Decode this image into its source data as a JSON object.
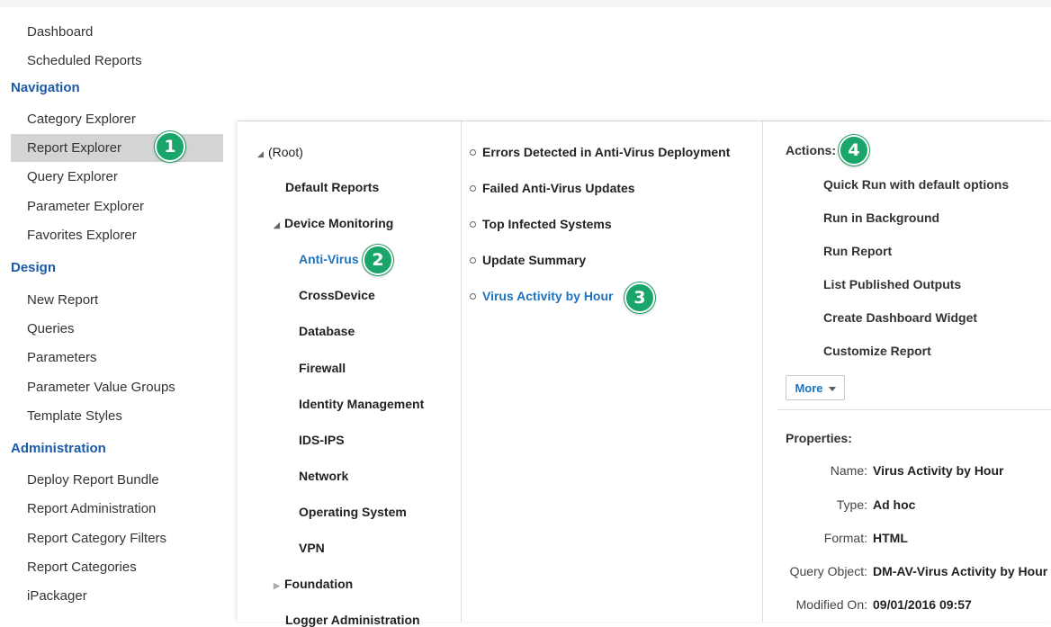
{
  "sidebar": {
    "top_items": [
      {
        "label": "Dashboard"
      },
      {
        "label": "Scheduled Reports"
      }
    ],
    "sections": [
      {
        "heading": "Navigation",
        "items": [
          {
            "label": "Category Explorer"
          },
          {
            "label": "Report Explorer",
            "selected": true
          },
          {
            "label": "Query Explorer"
          },
          {
            "label": "Parameter Explorer"
          },
          {
            "label": "Favorites Explorer"
          }
        ]
      },
      {
        "heading": "Design",
        "items": [
          {
            "label": "New Report"
          },
          {
            "label": "Queries"
          },
          {
            "label": "Parameters"
          },
          {
            "label": "Parameter Value Groups"
          },
          {
            "label": "Template Styles"
          }
        ]
      },
      {
        "heading": "Administration",
        "items": [
          {
            "label": "Deploy Report Bundle"
          },
          {
            "label": "Report Administration"
          },
          {
            "label": "Report Category Filters"
          },
          {
            "label": "Report Categories"
          },
          {
            "label": "iPackager"
          }
        ]
      }
    ]
  },
  "badges": [
    "1",
    "2",
    "3",
    "4"
  ],
  "tree": {
    "root": "(Root)",
    "default_reports": "Default Reports",
    "device_monitoring": "Device Monitoring",
    "children": [
      "Anti-Virus",
      "CrossDevice",
      "Database",
      "Firewall",
      "Identity Management",
      "IDS-IPS",
      "Network",
      "Operating System",
      "VPN"
    ],
    "foundation": "Foundation",
    "logger_admin": "Logger Administration"
  },
  "reports": [
    "Errors Detected in Anti-Virus Deployment",
    "Failed Anti-Virus Updates",
    "Top Infected Systems",
    "Update Summary",
    "Virus Activity by Hour"
  ],
  "actions": {
    "label": "Actions:",
    "items": [
      "Quick Run with default options",
      "Run in Background",
      "Run Report",
      "List Published Outputs",
      "Create Dashboard Widget",
      "Customize Report"
    ],
    "more": "More"
  },
  "properties": {
    "label": "Properties:",
    "rows": [
      {
        "key": "Name:",
        "value": "Virus Activity by Hour"
      },
      {
        "key": "Type:",
        "value": "Ad hoc"
      },
      {
        "key": "Format:",
        "value": "HTML"
      },
      {
        "key": "Query Object:",
        "value": "DM-AV-Virus Activity by Hour"
      },
      {
        "key": "Modified On:",
        "value": "09/01/2016 09:57"
      }
    ]
  },
  "colors": {
    "heading": "#1c5aa6",
    "link": "#1e73be",
    "badge": "#1aa66a",
    "selected_bg": "#d4d4d4"
  }
}
